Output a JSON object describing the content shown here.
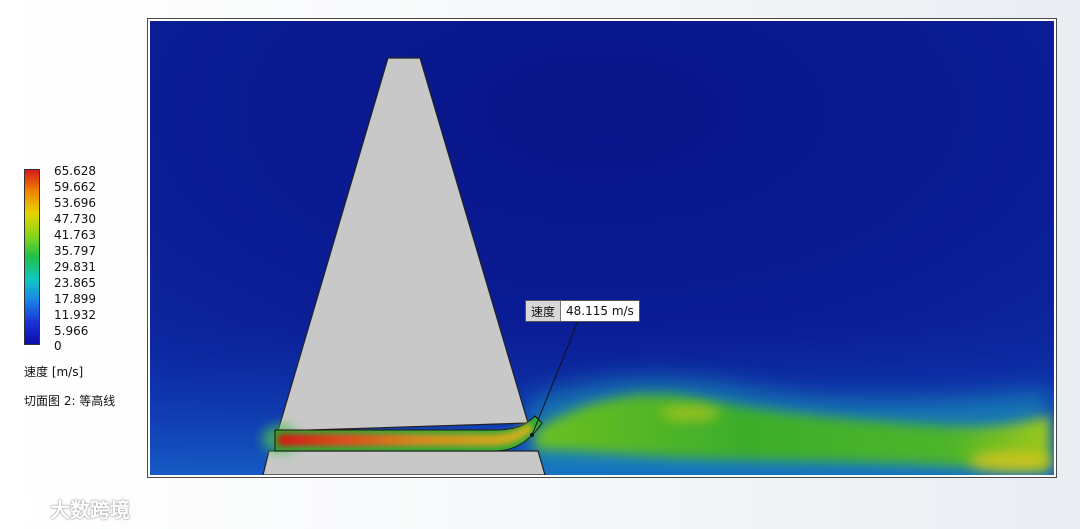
{
  "legend": {
    "ticks": [
      "65.628",
      "59.662",
      "53.696",
      "47.730",
      "41.763",
      "35.797",
      "29.831",
      "23.865",
      "17.899",
      "11.932",
      "5.966",
      "0"
    ],
    "unit_label": "速度 [m/s]",
    "colors": [
      "#d7191c",
      "#f08a00",
      "#e6d400",
      "#84d61a",
      "#1fbf4a",
      "#10c8c2",
      "#1a84e6",
      "#1a2fd6",
      "#0e0ea8"
    ]
  },
  "plot": {
    "caption": "切面图 2: 等高线",
    "background_color": "#0b1e96",
    "obstacle_color": "#c8c8c8"
  },
  "probe": {
    "label": "速度",
    "value": "48.115 m/s"
  },
  "watermark": {
    "text": "大数跨境",
    "logo_icon": "cloud-logo-icon"
  }
}
